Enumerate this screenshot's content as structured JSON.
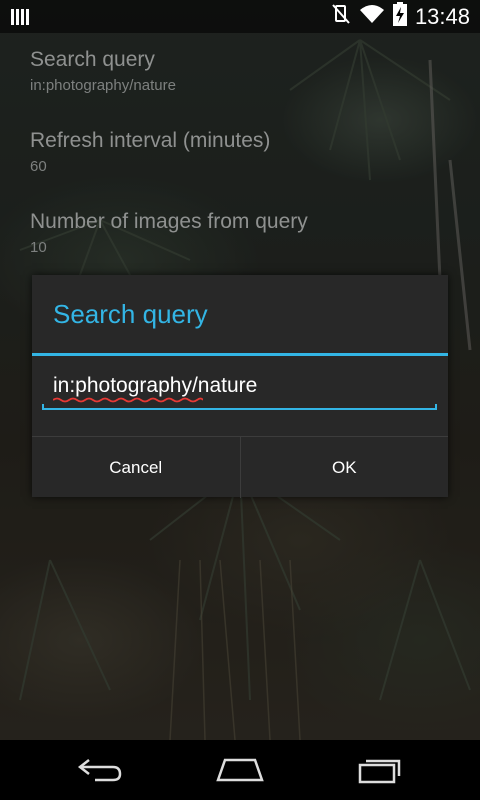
{
  "status_bar": {
    "time": "13:48",
    "icons": [
      "notification-bars-icon",
      "vibrate-off-icon",
      "wifi-icon",
      "battery-charging-icon"
    ]
  },
  "preferences": [
    {
      "title": "Search query",
      "summary": "in:photography/nature"
    },
    {
      "title": "Refresh interval (minutes)",
      "summary": "60"
    },
    {
      "title": "Number of images from query",
      "summary": "10"
    }
  ],
  "dialog": {
    "title": "Search query",
    "input_value": "in:photography/nature",
    "cancel_label": "Cancel",
    "ok_label": "OK"
  },
  "colors": {
    "accent": "#33b5e5",
    "dialog_bg": "#282828",
    "spellcheck": "#e53935"
  },
  "nav_bar": {
    "icons": [
      "back-icon",
      "home-icon",
      "recent-apps-icon"
    ]
  }
}
